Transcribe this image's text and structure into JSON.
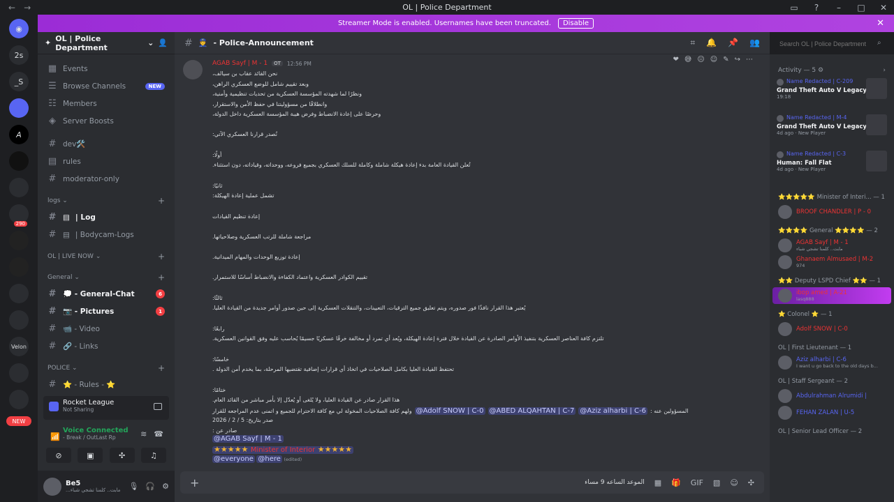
{
  "titlebar": {
    "title": "OL | Police Department"
  },
  "banner": {
    "text": "Streamer Mode is enabled. Usernames have been truncated.",
    "disable_label": "Disable"
  },
  "guilds": [
    "2s",
    "_S",
    "",
    "",
    "",
    "",
    "290",
    "",
    "",
    "",
    "",
    "",
    "Velon",
    "",
    "",
    ""
  ],
  "new_label": "NEW",
  "server": {
    "name": "OL | Police Department"
  },
  "channels": {
    "top": [
      {
        "label": "Events",
        "icon": "calendar-icon"
      },
      {
        "label": "Browse Channels",
        "icon": "browse-icon",
        "badge": "NEW"
      },
      {
        "label": "Members",
        "icon": "members-icon"
      },
      {
        "label": "Server Boosts",
        "icon": "boost-icon"
      }
    ],
    "list1": [
      {
        "label": "dev🛠️"
      },
      {
        "label": "rules"
      },
      {
        "label": "moderator-only"
      }
    ],
    "logs_cat": "logs",
    "logs": [
      {
        "label": "| Log",
        "bright": true
      },
      {
        "label": "| Bodycam-Logs"
      }
    ],
    "live_cat": "OL | LIVE NOW",
    "general_cat": "General",
    "general": [
      {
        "label": "💭 - General-Chat",
        "count": "6",
        "bright": true
      },
      {
        "label": "📷 - Pictures",
        "count": "1",
        "bright": true
      },
      {
        "label": "📹 - Video"
      },
      {
        "label": "🔗 - Links"
      }
    ],
    "police_cat": "POLICE",
    "police": [
      {
        "label": "⭐ - Rules - ⭐"
      }
    ]
  },
  "activity": {
    "game": "Rocket League",
    "status": "Not Sharing"
  },
  "voice": {
    "status": "Voice Connected",
    "channel": "- Break / OutLast Rp"
  },
  "user": {
    "name": "Be5",
    "status": "...مابت.. كلمنا تشجي شباء"
  },
  "channel_header": {
    "name": "- Police-Announcement"
  },
  "message": {
    "author": "AGAB Sayf | M - 1",
    "tag": "OT",
    "time": "12:56 PM",
    "lines": [
      "نحن القائد عقاب بن سيالف،",
      "وبعد تقييم شامل للوضع العسكري الراهن،",
      "ونظرًا لما شهدته المؤسسة العسكرية من تحديات تنظيمية وأمنية،",
      "وانطلاقًا من مسؤوليتنا في حفظ الأمن والاستقرار،",
      "وحرصًا على إعادة الانضباط وفرض هيبة المؤسسة العسكرية داخل الدولة،",
      "نُصدر قرارنا العسكري الآتي:",
      "أولًا:",
      "تُعلن القيادة العامة بدء إعادة هيكلة شاملة وكاملة للسلك العسكري بجميع فروعه، ووحداته، وقياداته، دون استثناء.",
      "ثانيًا:",
      "تشمل عملية إعادة الهيكلة:",
      "إعادة تنظيم القيادات",
      "مراجعة شاملة للرتب العسكرية وصلاحياتها.",
      "إعادة توزيع الوحدات والمهام الميدانية.",
      "تقييم الكوادر العسكرية واعتماد الكفاءة والانضباط أساسًا للاستمرار.",
      "ثالثًا:",
      "يُعتبر هذا القرار نافذًا فور صدوره، ويتم تعليق جميع الترقيات، التعيينات، والتنقلات العسكرية إلى حين صدور أوامر جديدة من القيادة العليا.",
      "رابعًا:",
      "تلتزم كافة العناصر العسكرية بتنفيذ الأوامر الصادرة عن القيادة خلال فترة إعادة الهيكلة، ويُعد أي تمرد أو مخالفة خرقًا عسكريًا جسيمًا يُحاسب عليه وفق القوانين العسكرية.",
      "خامسًا:",
      "تحتفظ القيادة العليا بكامل الصلاحيات في اتخاذ أي قرارات إضافية تقتضيها المرحلة، بما يخدم أمن الدولة .",
      "ختامًا:",
      "هذا القرار صادر عن القيادة العليا، ولا يُلغى أو يُعدّل إلا بأمر مباشر من القائد العام.",
      "ولهم كافة الصلاحيات المخولة لي مع كافة الاحترام للجميع و اتمنى عدم المراجعه للقرار",
      "صدر بتاريخ: 5 / 2 / 2026",
      "صادر عن :"
    ],
    "responsible_label": "المسؤولين عنه :",
    "mentions": [
      "@Adolf SNOW | C-0",
      "@ABED ALQAHTAN | C-7",
      "@Aziz alharbi | C-6"
    ],
    "signer_mention": "@AGAB Sayf | M - 1",
    "minister_line": "Minister of Interior",
    "everyone": "@everyone",
    "here": "@here",
    "edited": "(edited)"
  },
  "composer": {
    "draft": "الموعد الساعه 9 مساء"
  },
  "search": {
    "placeholder": "Search OL | Police Department"
  },
  "members_panel": {
    "activity_header": "Activity — 5",
    "activities": [
      {
        "user": "Name Redacted | C-209",
        "game": "Grand Theft Auto V Legacy",
        "status": "19:18"
      },
      {
        "user": "Name Redacted | M-4",
        "game": "Grand Theft Auto V Legacy",
        "status": "4d ago · New Player"
      },
      {
        "user": "Name Redacted | C-3",
        "game": "Human: Fall Flat",
        "status": "4d ago · New Player"
      }
    ],
    "groups": [
      {
        "role": "⭐⭐⭐⭐⭐ Minister of Interi... — 1",
        "members": [
          {
            "name": "BROOF CHANDLER | P - 0",
            "color": "red"
          }
        ]
      },
      {
        "role": "⭐⭐⭐⭐ General ⭐⭐⭐⭐ — 2",
        "members": [
          {
            "name": "AGAB Sayf | M - 1",
            "color": "red",
            "sub": "مابت.. كلمنا تشجي شباء"
          },
          {
            "name": "Ghanaem Almusaed | M-2",
            "color": "red",
            "sub": "974"
          }
        ]
      },
      {
        "role": "⭐⭐ Deputy LSPD Chief ⭐⭐ — 1",
        "members": [
          {
            "name": "ibop amed | A-21",
            "color": "red",
            "sub": "lasq888",
            "hl": true
          }
        ]
      },
      {
        "role": "⭐ Colonel ⭐ — 1",
        "members": [
          {
            "name": "Adolf SNOW | C-0",
            "color": "red"
          }
        ]
      },
      {
        "role": "OL | First Lieutenant — 1",
        "members": [
          {
            "name": "Aziz alharbi | C-6",
            "color": "blue",
            "sub": "I want u go back to the old days b..."
          }
        ]
      },
      {
        "role": "OL | Staff Sergeant — 2",
        "members": [
          {
            "name": "Abdulrahman Alrumidi |",
            "color": "blue"
          },
          {
            "name": "FEHAN ZALAN | U-5",
            "color": "blue"
          }
        ]
      },
      {
        "role": "OL | Senior Lead Officer — 2",
        "members": []
      }
    ]
  }
}
